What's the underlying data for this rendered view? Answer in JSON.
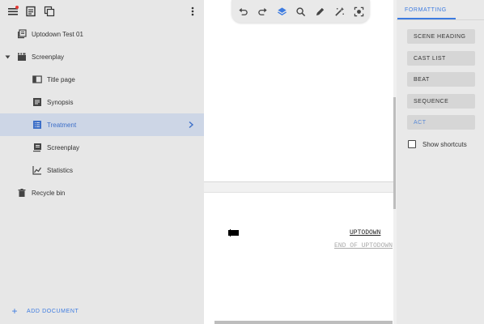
{
  "sidebar": {
    "project_title": "Uptodown Test 01",
    "items": [
      {
        "label": "Screenplay",
        "icon": "clapperboard-icon"
      },
      {
        "label": "Title page",
        "icon": "title-page-icon"
      },
      {
        "label": "Synopsis",
        "icon": "document-icon"
      },
      {
        "label": "Treatment",
        "icon": "list-icon"
      },
      {
        "label": "Screenplay",
        "icon": "script-icon"
      },
      {
        "label": "Statistics",
        "icon": "chart-icon"
      },
      {
        "label": "Recycle bin",
        "icon": "trash-icon"
      }
    ],
    "add_document": "ADD DOCUMENT"
  },
  "editor": {
    "scene_text": "UPTODOWN",
    "end_text": "END OF UPTODOWN"
  },
  "panel": {
    "tab": "FORMATTING",
    "buttons": [
      "SCENE HEADING",
      "CAST LIST",
      "BEAT",
      "SEQUENCE",
      "ACT"
    ],
    "show_shortcuts": "Show shortcuts"
  },
  "colors": {
    "accent": "#3d7be0",
    "selected_bg": "#cdd6e6",
    "notification": "#e53935"
  }
}
